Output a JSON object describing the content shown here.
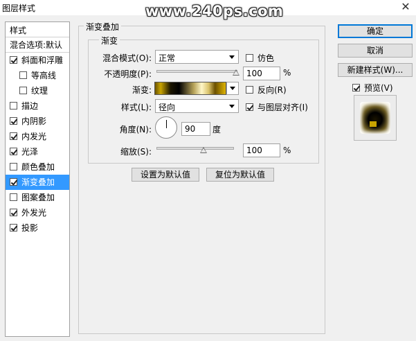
{
  "window": {
    "title": "图层样式",
    "watermark": "www.240ps.com",
    "close_glyph": "✕"
  },
  "left_panel": {
    "header": "样式",
    "blend_options": "混合选项:默认",
    "items": [
      {
        "label": "斜面和浮雕",
        "checked": true,
        "sub": false,
        "selected": false
      },
      {
        "label": "等高线",
        "checked": false,
        "sub": true,
        "selected": false
      },
      {
        "label": "纹理",
        "checked": false,
        "sub": true,
        "selected": false
      },
      {
        "label": "描边",
        "checked": false,
        "sub": false,
        "selected": false
      },
      {
        "label": "内阴影",
        "checked": true,
        "sub": false,
        "selected": false
      },
      {
        "label": "内发光",
        "checked": true,
        "sub": false,
        "selected": false
      },
      {
        "label": "光泽",
        "checked": true,
        "sub": false,
        "selected": false
      },
      {
        "label": "颜色叠加",
        "checked": false,
        "sub": false,
        "selected": false
      },
      {
        "label": "渐变叠加",
        "checked": true,
        "sub": false,
        "selected": true
      },
      {
        "label": "图案叠加",
        "checked": false,
        "sub": false,
        "selected": false
      },
      {
        "label": "外发光",
        "checked": true,
        "sub": false,
        "selected": false
      },
      {
        "label": "投影",
        "checked": true,
        "sub": false,
        "selected": false
      }
    ]
  },
  "gradient_overlay": {
    "section_title": "渐变叠加",
    "group_title": "渐变",
    "blend_mode_label": "混合模式(O):",
    "blend_mode_value": "正常",
    "dither_label": "仿色",
    "dither_checked": false,
    "opacity_label": "不透明度(P):",
    "opacity_value": "100",
    "opacity_percent": 100,
    "opacity_unit": "%",
    "gradient_label": "渐变:",
    "reverse_label": "反向(R)",
    "reverse_checked": false,
    "style_label": "样式(L):",
    "style_value": "径向",
    "align_label": "与图层对齐(I)",
    "align_checked": true,
    "angle_label": "角度(N):",
    "angle_value": "90",
    "angle_unit": "度",
    "scale_label": "缩放(S):",
    "scale_value": "100",
    "scale_unit": "%",
    "make_default": "设置为默认值",
    "reset_default": "复位为默认值"
  },
  "buttons": {
    "ok": "确定",
    "cancel": "取消",
    "new_style": "新建样式(W)...",
    "preview_label": "预览(V)",
    "preview_checked": true
  },
  "colors": {
    "selection": "#3399ff",
    "primary_border": "#0078d7"
  }
}
